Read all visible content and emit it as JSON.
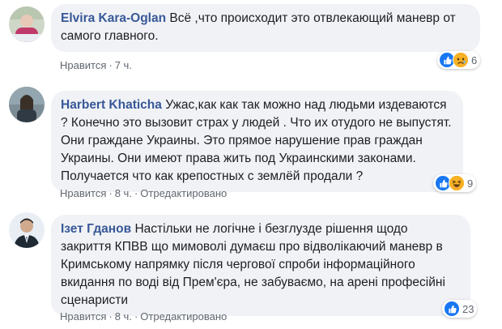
{
  "comments": [
    {
      "author": "Elvira Kara-Oglan",
      "text": "Всё ,что происходит это отвлекающий маневр от самого главного.",
      "like_label": "Нравится",
      "time": "7 ч.",
      "edited_label": "",
      "reaction_count": "6",
      "reactions": [
        "like-icon",
        "sad-icon"
      ]
    },
    {
      "author": "Harbert Khaticha",
      "text": "Ужас,как как так можно над людьми издеваются ? Конечно это вызовит страх у людей . Что их отудого не выпустят. Они граждане Украины. Это прямое нарушение прав граждан Украины. Они имеют права жить под Украинскими законами. Получается что как крепостных с землёй продали ?",
      "like_label": "Нравится",
      "time": "8 ч.",
      "edited_label": "Отредактировано",
      "reaction_count": "9",
      "reactions": [
        "like-icon",
        "haha-icon"
      ]
    },
    {
      "author": "Iзет Гданов",
      "text": "Настільки не логічне і безглузде рішення щодо закриття КПВВ що мимоволі думаєш про відволікаючий маневр в Кримському напрямку після чергової спроби інформаційного вкидання по воді від Прем'єра, не забуваємо, на арені професійні сценаристи",
      "like_label": "Нравится",
      "time": "8 ч.",
      "edited_label": "Отредактировано",
      "reaction_count": "23",
      "reactions": [
        "like-icon"
      ]
    }
  ],
  "colors": {
    "author": "#385898",
    "bubble": "#f0f2f5",
    "meta": "#606770",
    "like_blue": "#1877f2",
    "emoji_yellow": "#f7b125"
  }
}
